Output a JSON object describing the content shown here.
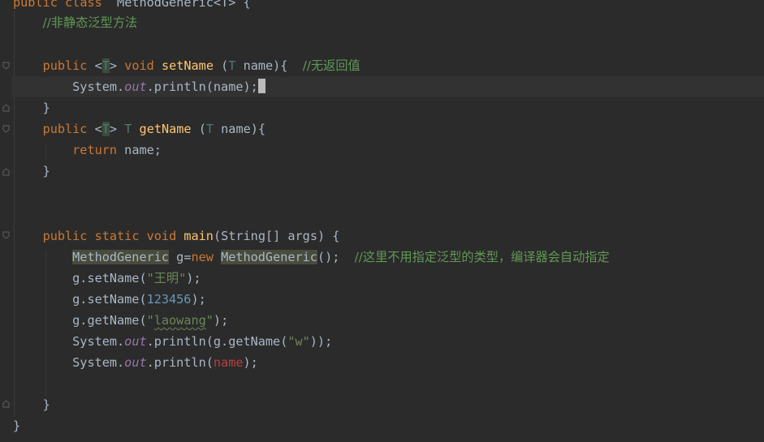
{
  "editor": {
    "language": "Java",
    "lines": {
      "l0": {
        "kw1": "public",
        "kw2": "class",
        "name": "MethodGeneric",
        "tp": "<T>",
        "rest": " {"
      },
      "l1": {
        "comment": "//非静态泛型方法"
      },
      "l3": {
        "kw": "public",
        "lt": "<",
        "tp": "T",
        "gt": ">",
        "void": "void",
        "fn": "setName",
        "p1": " (",
        "ptype": "T",
        "p2": " name){  ",
        "comment": "//无返回值"
      },
      "l4": {
        "sys": "System.",
        "out": "out",
        "call": ".println(name);"
      },
      "l5": {
        "brace": "}"
      },
      "l6": {
        "kw": "public",
        "lt": "<",
        "tp": "T",
        "gt": ">",
        "rtype": "T",
        "fn": "getName",
        "p1": " (",
        "ptype": "T",
        "p2": " name){"
      },
      "l7": {
        "ret": "return",
        "rest": " name;"
      },
      "l8": {
        "brace": "}"
      },
      "l11": {
        "kw1": "public",
        "kw2": "static",
        "kw3": "void",
        "fn": "main",
        "rest": "(String[] args) {"
      },
      "l12": {
        "type1": "MethodGeneric",
        "mid": " g=",
        "new": "new",
        "type2": "MethodGeneric",
        "end": "();  ",
        "comment": "//这里不用指定泛型的类型，编译器会自动指定"
      },
      "l13": {
        "pre": "g.setName(",
        "str": "\"王明\"",
        "post": ");"
      },
      "l14": {
        "pre": "g.setName(",
        "num": "123456",
        "post": ");"
      },
      "l15": {
        "pre": "g.getName(",
        "q1": "\"",
        "str": "laowang",
        "q2": "\"",
        "post": ");"
      },
      "l16": {
        "sys": "System.",
        "out": "out",
        "mid": ".println(g.getName(",
        "str": "\"w\"",
        "post": "));"
      },
      "l17": {
        "sys": "System.",
        "out": "out",
        "mid": ".println(",
        "err": "name",
        "post": ");"
      },
      "l19": {
        "brace": "}"
      },
      "l20": {
        "brace": "}"
      }
    },
    "colors": {
      "background": "#2b2b2b",
      "keyword": "#cc7832",
      "method": "#ffc66d",
      "comment": "#629755",
      "string": "#6a8759",
      "number": "#6897bb",
      "static_field": "#9876aa",
      "error": "#bc3f3c"
    }
  }
}
